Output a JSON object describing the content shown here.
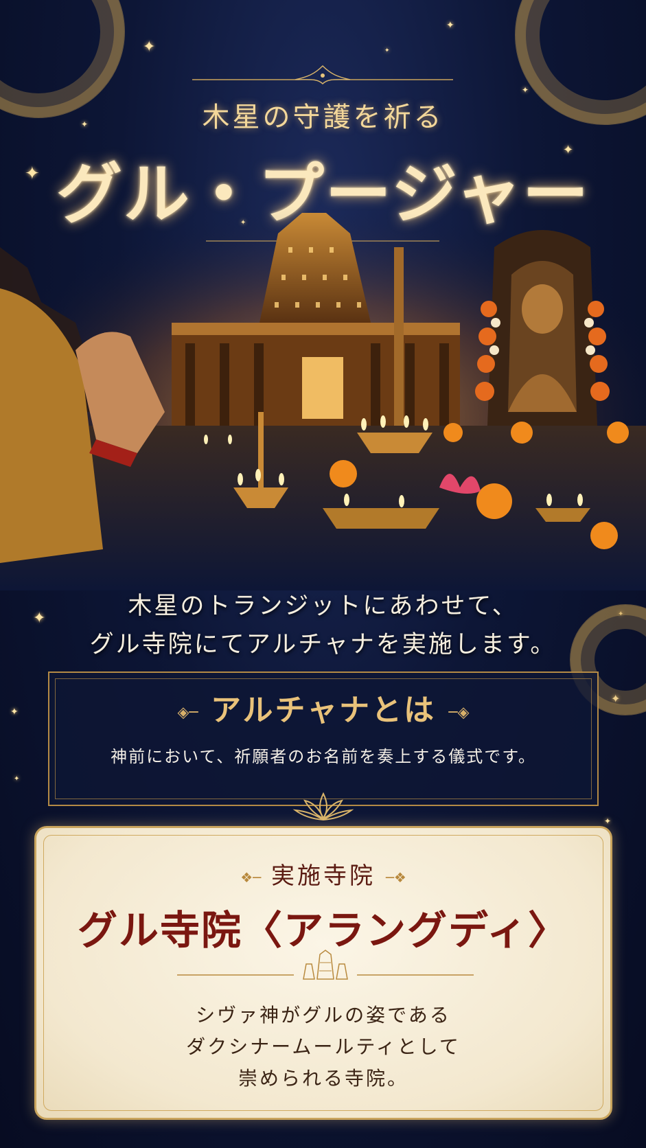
{
  "header": {
    "subtitle": "木星の守護を祈る",
    "title": "グル・プージャー"
  },
  "intro": {
    "line1": "木星のトランジットにあわせて、",
    "line2": "グル寺院にてアルチャナを実施します。"
  },
  "archana": {
    "heading": "アルチャナとは",
    "description": "神前において、祈願者のお名前を奏上する儀式です。"
  },
  "temple": {
    "label": "実施寺院",
    "name": "グル寺院〈アラングディ〉",
    "description_lines": [
      "シヴァ神がグルの姿である",
      "ダクシナームールティとして",
      "崇められる寺院。"
    ]
  },
  "colors": {
    "night_sky": "#0d1636",
    "gold": "#c9a45d",
    "title_glow": "#fbe8bd",
    "parchment": "#f3e8cf",
    "temple_name": "#7a1710"
  },
  "icons": [
    "star-icon",
    "lotus-icon",
    "temple-gopuram-icon",
    "flourish-icon",
    "mandala-icon"
  ]
}
